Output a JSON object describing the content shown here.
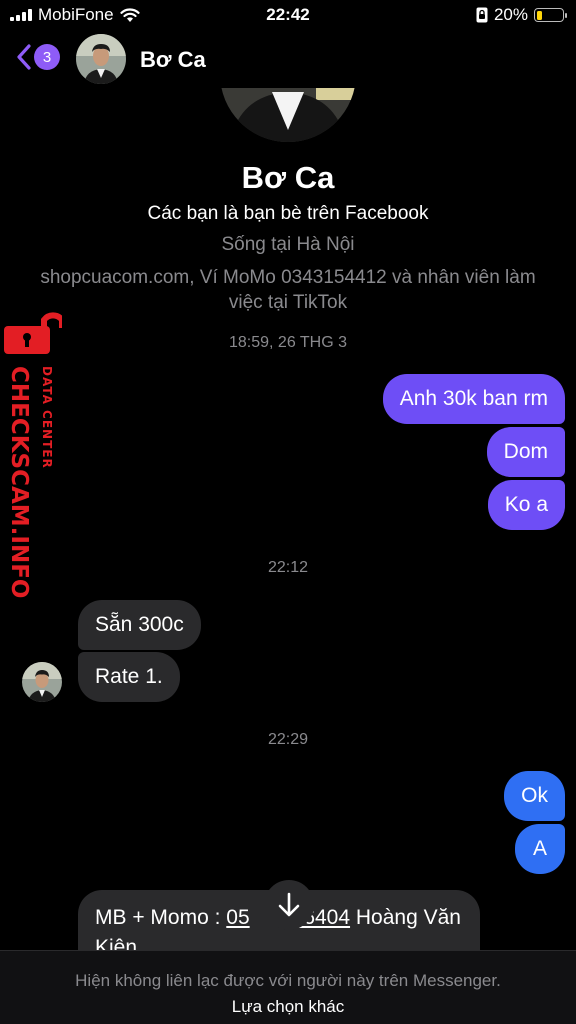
{
  "status_bar": {
    "carrier": "MobiFone",
    "time": "22:42",
    "battery": "20%",
    "battery_level": 0.2,
    "battery_color": "#ffd60a"
  },
  "header": {
    "back_badge": "3",
    "contact_name": "Bơ Ca"
  },
  "profile": {
    "name": "Bơ Ca",
    "friends": "Các bạn là bạn bè trên Facebook",
    "lives": "Sống tại Hà Nội",
    "work": "shopcuacom.com, Ví MoMo 0343154412 và nhân viên làm việc tại TikTok"
  },
  "timestamps": {
    "t1": "18:59, 26 THG 3",
    "t2": "22:12",
    "t3": "22:29"
  },
  "messages": {
    "out1": "Anh 30k ban rm",
    "out2": "Dom",
    "out3": "Ko a",
    "in1": "Sẵn 300c",
    "in2": "Rate 1.",
    "out4": "Ok",
    "out5": "A",
    "in3_prefix": "MB + Momo : ",
    "in3_link": "05",
    "in3_link2": "36404",
    "in3_suffix": " Hoàng Văn Kiện"
  },
  "footer": {
    "note": "Hiện không liên lạc được với người này trên Messenger.",
    "link": "Lựa chọn khác"
  },
  "watermark": {
    "main": "CHECKSCAM.INFO",
    "sub": "DATA CENTER"
  },
  "colors": {
    "outgoing": "#6e4ef6",
    "outgoing_blue": "#2f6ff3",
    "incoming": "#2a2a2c",
    "accent": "#8e5cf7",
    "watermark": "#e31e24"
  }
}
